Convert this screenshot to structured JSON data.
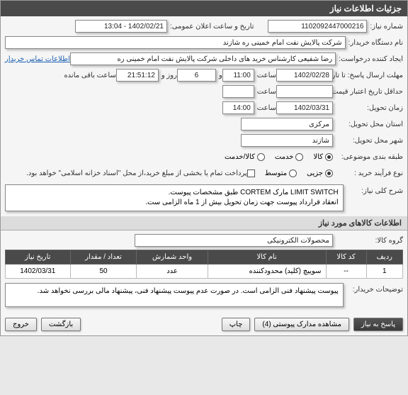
{
  "header": {
    "title": "جزئیات اطلاعات نیاز"
  },
  "fields": {
    "need_number_label": "شماره نیاز:",
    "need_number": "1102092447000216",
    "public_announce_label": "تاریخ و ساعت اعلان عمومی:",
    "public_announce": "1402/02/21 - 13:04",
    "buyer_org_label": "نام دستگاه خریدار:",
    "buyer_org": "شرکت پالایش نفت امام خمینی  ره  شازند",
    "requester_label": "ایجاد کننده درخواست:",
    "requester": "رضا  شفیعی  کارشناس خرید های داخلی  شرکت پالایش نفت امام خمینی  ره",
    "contact_link": "اطلاعات تماس خریدار",
    "deadline_label": "مهلت ارسال پاسخ: تا تاریخ:",
    "deadline_date": "1402/02/28",
    "time_label": "ساعت",
    "deadline_time": "11:00",
    "days_and": "و",
    "days_value": "6",
    "days_label": "روز و",
    "remaining_time": "21:51:12",
    "remaining_label": "ساعت باقی مانده",
    "validity_label": "حداقل تاریخ اعتبار قیمت: تا تاریخ:",
    "delivery_date_label": "زمان تحویل:",
    "delivery_date": "1402/03/31",
    "delivery_time": "14:00",
    "delivery_province_label": "استان محل تحویل:",
    "delivery_province": "مرکزی",
    "delivery_city_label": "شهر محل تحویل:",
    "delivery_city": "شازند",
    "category_label": "طبقه بندی موضوعی:",
    "purchase_type_label": "نوع فرآیند خرید :",
    "payment_note": "پرداخت تمام یا بخشی از مبلغ خرید،از محل \"اسناد خزانه اسلامی\" خواهد بود."
  },
  "radios": {
    "category": [
      {
        "label": "کالا",
        "checked": true
      },
      {
        "label": "خدمت",
        "checked": false
      },
      {
        "label": "کالا/خدمت",
        "checked": false
      }
    ],
    "purchase_type": [
      {
        "label": "جزیی",
        "checked": true
      },
      {
        "label": "متوسط",
        "checked": false
      }
    ]
  },
  "description": {
    "label": "شرح کلی نیاز:",
    "text": "LIMIT SWITCH مارک CORTEM طبق مشخصات پیوست.\nانعقاد قرارداد پیوست جهت زمان تحویل بیش از 1 ماه الزامی ست."
  },
  "items_section": {
    "title": "اطلاعات کالاهای مورد نیاز",
    "group_label": "گروه کالا:",
    "group_value": "محصولات الکترونیکی"
  },
  "table": {
    "headers": {
      "row": "ردیف",
      "code": "کد کالا",
      "name": "نام کالا",
      "unit": "واحد شمارش",
      "qty": "تعداد / مقدار",
      "date": "تاریخ نیاز"
    },
    "rows": [
      {
        "row": "1",
        "code": "--",
        "name": "سوییچ (کلید) محدودکننده",
        "unit": "عدد",
        "qty": "50",
        "date": "1402/03/31"
      }
    ]
  },
  "buyer_notes": {
    "label": "توضیحات خریدار:",
    "text": "پیوست پیشنهاد فنی الزامی است. در صورت عدم پیوست پیشنهاد فنی، پیشنهاد مالی بررسی نخواهد شد."
  },
  "buttons": {
    "respond": "پاسخ به نیاز",
    "attachments": "مشاهده مدارک پیوستی (4)",
    "print": "چاپ",
    "back": "بازگشت",
    "exit": "خروج"
  }
}
